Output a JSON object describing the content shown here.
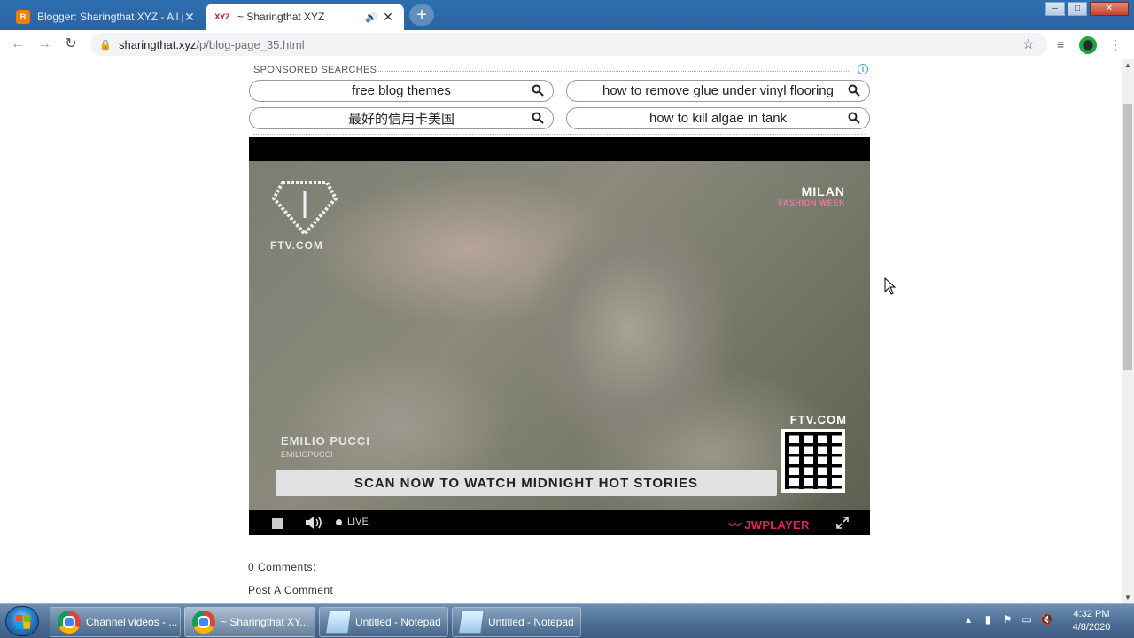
{
  "browser": {
    "tabs": [
      {
        "title": "Blogger: Sharingthat XYZ - All pa",
        "favicon": "blogger-icon",
        "active": false
      },
      {
        "title": "~ Sharingthat XYZ",
        "favicon": "xyz-icon",
        "favicon_text": "XYZ",
        "active": true
      }
    ],
    "address": {
      "domain": "sharingthat.xyz",
      "path": "/p/blog-page_35.html"
    }
  },
  "page": {
    "sponsored_label": "SPONSORED SEARCHES",
    "searches": [
      {
        "label": "free blog themes"
      },
      {
        "label": "how to remove glue under vinyl flooring"
      },
      {
        "label": "最好的信用卡美国"
      },
      {
        "label": "how to kill algae in tank"
      }
    ],
    "video": {
      "brand_small": "FTV.COM",
      "corner_title": "MILAN",
      "corner_sub": "FASHION WEEK",
      "site_label": "FTV.COM",
      "designer": "EMILIO PUCCI",
      "designer_handle": "EMILIOPUCCI",
      "banner": "SCAN NOW TO WATCH MIDNIGHT HOT STORIES",
      "live_label": "LIVE",
      "player_brand": "JWPLAYER"
    },
    "comments_count": "0 Comments:",
    "post_comment": "Post A Comment"
  },
  "taskbar": {
    "tasks": [
      {
        "label": "Channel videos - ...",
        "icon": "chrome-icon"
      },
      {
        "label": "~ Sharingthat XY...",
        "icon": "chrome-icon"
      },
      {
        "label": "Untitled - Notepad",
        "icon": "notepad-icon"
      },
      {
        "label": "Untitled - Notepad",
        "icon": "notepad-icon"
      }
    ],
    "clock": {
      "time": "4:32 PM",
      "date": "4/8/2020"
    }
  },
  "colors": {
    "titlebar": "#2e6fb0",
    "jw_accent": "#e0245e",
    "info_accent": "#4aa3df"
  }
}
